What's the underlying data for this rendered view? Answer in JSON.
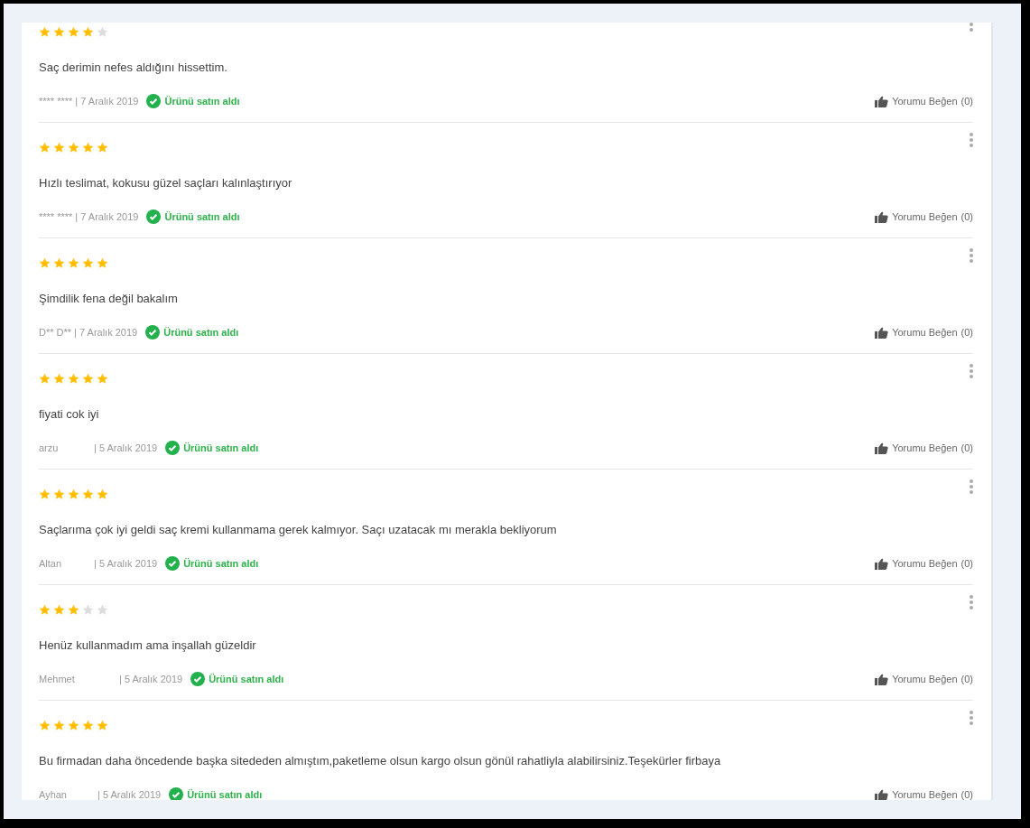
{
  "reviews": [
    {
      "stars": 4,
      "text": "Saç derimin nefes aldığını hissettim.",
      "author": "**** ****",
      "date": "| 7 Aralık 2019",
      "badge": "Ürünü satın aldı",
      "like_label": "Yorumu Beğen",
      "like_count": "(0)"
    },
    {
      "stars": 5,
      "text": "Hızlı teslimat, kokusu güzel saçları kalınlaştırıyor",
      "author": "**** ****",
      "date": "| 7 Aralık 2019",
      "badge": "Ürünü satın aldı",
      "like_label": "Yorumu Beğen",
      "like_count": "(0)"
    },
    {
      "stars": 5,
      "text": "Şimdilik fena değil bakalım",
      "author": "D** D**",
      "date": "| 7 Aralık 2019",
      "badge": "Ürünü satın aldı",
      "like_label": "Yorumu Beğen",
      "like_count": "(0)"
    },
    {
      "stars": 5,
      "text": "fiyati cok iyi",
      "author": "arzu",
      "date": "| 5 Aralık 2019",
      "badge": "Ürünü satın aldı",
      "like_label": "Yorumu Beğen",
      "like_count": "(0)"
    },
    {
      "stars": 5,
      "text": "Saçlarıma çok iyi geldi saç kremi kullanmama gerek kalmıyor. Saçı uzatacak mı merakla bekliyorum",
      "author": "Altan",
      "date": "| 5 Aralık 2019",
      "badge": "Ürünü satın aldı",
      "like_label": "Yorumu Beğen",
      "like_count": "(0)"
    },
    {
      "stars": 3,
      "text": "Henüz kullanmadım ama inşallah güzeldir",
      "author": "Mehmet",
      "date": "| 5 Aralık 2019",
      "badge": "Ürünü satın aldı",
      "like_label": "Yorumu Beğen",
      "like_count": "(0)"
    },
    {
      "stars": 5,
      "text": "Bu firmadan daha öncedende başka sitededen almıştım,paketleme olsun kargo olsun gönül rahatliyla alabilirsiniz.Teşekürler firbaya",
      "author": "Ayhan",
      "date": "| 5 Aralık 2019",
      "badge": "Ürünü satın aldı",
      "like_label": "Yorumu Beğen",
      "like_count": "(0)"
    }
  ]
}
